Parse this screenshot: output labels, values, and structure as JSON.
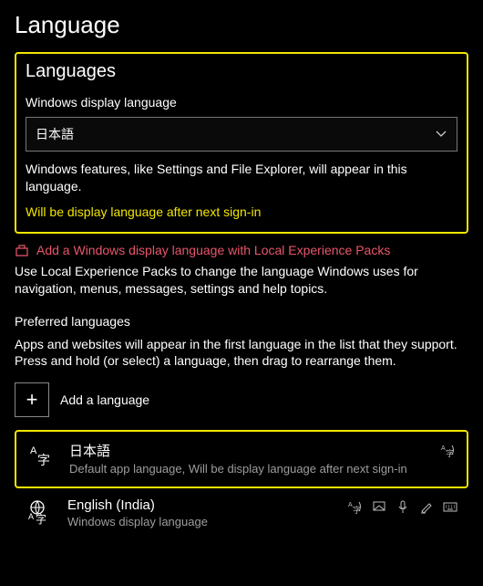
{
  "page_title": "Language",
  "section_title": "Languages",
  "display_lang": {
    "label": "Windows display language",
    "selected": "日本語",
    "description": "Windows features, like Settings and File Explorer, will appear in this language.",
    "pending_note": "Will be display language after next sign-in"
  },
  "lep_link": "Add a Windows display language with Local Experience Packs",
  "lep_desc": "Use Local Experience Packs to change the language Windows uses for navigation, menus, messages, settings and help topics.",
  "pref": {
    "title": "Preferred languages",
    "desc": "Apps and websites will appear in the first language in the list that they support. Press and hold (or select) a language, then drag to rearrange them.",
    "add_label": "Add a language"
  },
  "lang_items": [
    {
      "name": "日本語",
      "subtitle": "Default app language, Will be display language after next sign-in"
    },
    {
      "name": "English (India)",
      "subtitle": "Windows display language"
    }
  ]
}
